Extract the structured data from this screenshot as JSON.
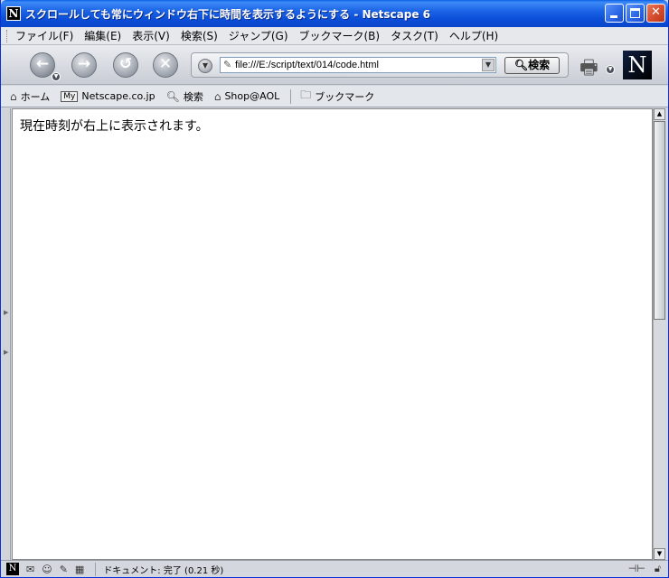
{
  "window": {
    "app_icon": "N",
    "title": "スクロールしても常にウィンドウ右下に時間を表示するようにする - Netscape 6"
  },
  "menu": {
    "items": [
      {
        "label": "ファイル(F)"
      },
      {
        "label": "編集(E)"
      },
      {
        "label": "表示(V)"
      },
      {
        "label": "検索(S)"
      },
      {
        "label": "ジャンプ(G)"
      },
      {
        "label": "ブックマーク(B)"
      },
      {
        "label": "タスク(T)"
      },
      {
        "label": "ヘルプ(H)"
      }
    ]
  },
  "nav": {
    "back_icon": "back-arrow-icon",
    "forward_icon": "forward-arrow-icon",
    "reload_icon": "reload-icon",
    "stop_icon": "stop-icon",
    "url": "file:///E:/script/text/014/code.html",
    "search_label": "検索",
    "logo": "N"
  },
  "personal_toolbar": {
    "items": [
      {
        "label": "ホーム"
      },
      {
        "label": "Netscape.co.jp",
        "badge": "My"
      },
      {
        "label": "検索"
      },
      {
        "label": "Shop@AOL"
      },
      {
        "label": "ブックマーク"
      }
    ]
  },
  "content": {
    "text": "現在時刻が右上に表示されます。"
  },
  "status": {
    "text": "ドキュメント: 完了 (0.21 秒)"
  },
  "colors": {
    "titlebar": "#0a4fd8",
    "close_button": "#d2482a",
    "content_bg": "#ffffff"
  }
}
